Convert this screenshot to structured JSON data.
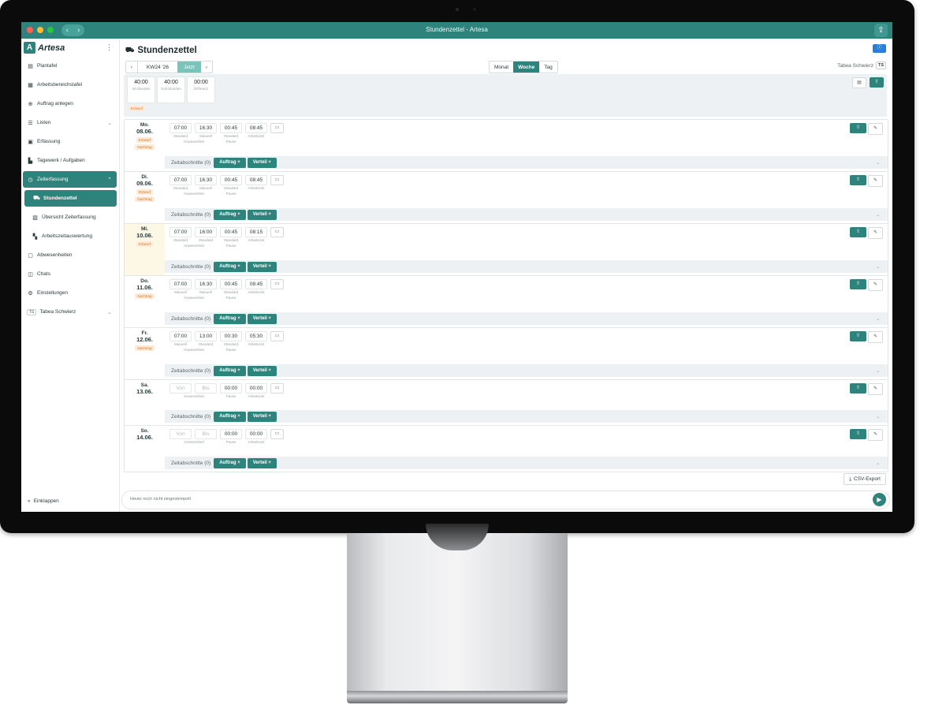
{
  "window": {
    "title": "Stundenzettel - Artesa"
  },
  "sidebar": {
    "brand": "Artesa",
    "items": [
      {
        "label": "Plantafel",
        "icon": "board-icon"
      },
      {
        "label": "Arbeitsbereichstafel",
        "icon": "calendar-icon"
      },
      {
        "label": "Auftrag anlegen",
        "icon": "plus-circle-icon"
      },
      {
        "label": "Listen",
        "icon": "list-icon"
      },
      {
        "label": "Erfassung",
        "icon": "document-icon"
      },
      {
        "label": "Tagewerk / Aufgaben",
        "icon": "chart-icon"
      },
      {
        "label": "Zeiterfassung",
        "icon": "clock-icon"
      },
      {
        "label": "Stundenzettel",
        "icon": "car-icon"
      },
      {
        "label": "Übersicht Zeiterfassung",
        "icon": "overview-icon"
      },
      {
        "label": "Arbeitszeitauswertung",
        "icon": "report-icon"
      },
      {
        "label": "Abwesenheiten",
        "icon": "absence-icon"
      },
      {
        "label": "Chats",
        "icon": "chat-icon"
      },
      {
        "label": "Einstellungen",
        "icon": "gears-icon"
      },
      {
        "label": "Tabea Schwierz",
        "initials": "TS"
      }
    ],
    "collapse_label": "Einklappen"
  },
  "header": {
    "title": "Stundenzettel",
    "week": "KW24 '26",
    "today_label": "Jetzt",
    "view_tabs": [
      "Monat",
      "Woche",
      "Tag"
    ],
    "selected_view": "Woche",
    "user_name": "Tabea Schwierz",
    "user_initials": "TS"
  },
  "summary": {
    "cards": [
      {
        "value": "40:00",
        "label": "Ist-Stunden"
      },
      {
        "value": "40:00",
        "label": "Soll-Stunden"
      },
      {
        "value": "00:00",
        "label": "Differenz"
      }
    ],
    "tag": "Entwurf"
  },
  "days": [
    {
      "name": "Mo.",
      "date": "08.06.",
      "tags": [
        "Entwurf",
        "Nachtrag"
      ],
      "times": [
        {
          "v": "07:00",
          "l": "Standard"
        },
        {
          "v": "16:30",
          "l": "Manuell"
        },
        {
          "v": "00:45",
          "l": "Standard"
        },
        {
          "v": "08:45",
          "l": ""
        }
      ],
      "sublabels": [
        "Anwesenheit",
        "Pause",
        "Arbeitszeit"
      ],
      "zeit": "Zeitabschnitte (0)"
    },
    {
      "name": "Di.",
      "date": "09.06.",
      "tags": [
        "Entwurf",
        "Nachtrag"
      ],
      "times": [
        {
          "v": "07:00",
          "l": "Standard"
        },
        {
          "v": "16:30",
          "l": "Manuell"
        },
        {
          "v": "00:45",
          "l": "Standard"
        },
        {
          "v": "08:45",
          "l": ""
        }
      ],
      "sublabels": [
        "Anwesenheit",
        "Pause",
        "Arbeitszeit"
      ],
      "zeit": "Zeitabschnitte (0)"
    },
    {
      "name": "Mi.",
      "date": "10.06.",
      "tags": [
        "Entwurf"
      ],
      "times": [
        {
          "v": "07:00",
          "l": "Standard"
        },
        {
          "v": "16:00",
          "l": "Standard"
        },
        {
          "v": "00:45",
          "l": "Standard"
        },
        {
          "v": "08:15",
          "l": ""
        }
      ],
      "sublabels": [
        "Anwesenheit",
        "Pause",
        "Arbeitszeit"
      ],
      "zeit": "Zeitabschnitte (0)"
    },
    {
      "name": "Do.",
      "date": "11.06.",
      "tags": [
        "Nachtrag"
      ],
      "times": [
        {
          "v": "07:00",
          "l": "Manuell"
        },
        {
          "v": "16:30",
          "l": "Manuell"
        },
        {
          "v": "00:45",
          "l": "Standard"
        },
        {
          "v": "08:45",
          "l": ""
        }
      ],
      "sublabels": [
        "Anwesenheit",
        "Pause",
        "Arbeitszeit"
      ],
      "zeit": "Zeitabschnitte (0)"
    },
    {
      "name": "Fr.",
      "date": "12.06.",
      "tags": [
        "Nachtrag"
      ],
      "times": [
        {
          "v": "07:00",
          "l": "Manuell"
        },
        {
          "v": "13:00",
          "l": "Standard"
        },
        {
          "v": "00:30",
          "l": "Standard"
        },
        {
          "v": "05:30",
          "l": ""
        }
      ],
      "sublabels": [
        "Anwesenheit",
        "Pause",
        "Arbeitszeit"
      ],
      "zeit": "Zeitabschnitte (0)"
    },
    {
      "name": "Sa.",
      "date": "13.06.",
      "tags": [],
      "times": [
        {
          "v": "Von",
          "l": ""
        },
        {
          "v": "Bis",
          "l": ""
        },
        {
          "v": "00:00",
          "l": ""
        },
        {
          "v": "00:00",
          "l": ""
        }
      ],
      "sublabels": [
        "Anwesenheit",
        "Pause",
        "Arbeitszeit"
      ],
      "zeit": "Zeitabschnitte (0)"
    },
    {
      "name": "So.",
      "date": "14.06.",
      "tags": [],
      "times": [
        {
          "v": "Von",
          "l": ""
        },
        {
          "v": "Bis",
          "l": ""
        },
        {
          "v": "00:00",
          "l": ""
        },
        {
          "v": "00:00",
          "l": ""
        }
      ],
      "sublabels": [
        "Anwesenheit",
        "Pause",
        "Arbeitszeit"
      ],
      "zeit": "Zeitabschnitte (0)"
    }
  ],
  "buttons": {
    "auftrag": "Auftrag +",
    "verteil": "Verteil +",
    "csv": "CSV-Export"
  },
  "stamp": {
    "text": "Heute noch nicht eingestempelt"
  },
  "colors": {
    "accent": "#2e837c",
    "tag_bg": "#fdebd9",
    "tag_fg": "#d7782b",
    "highlight_day": "#fdf7e6"
  }
}
